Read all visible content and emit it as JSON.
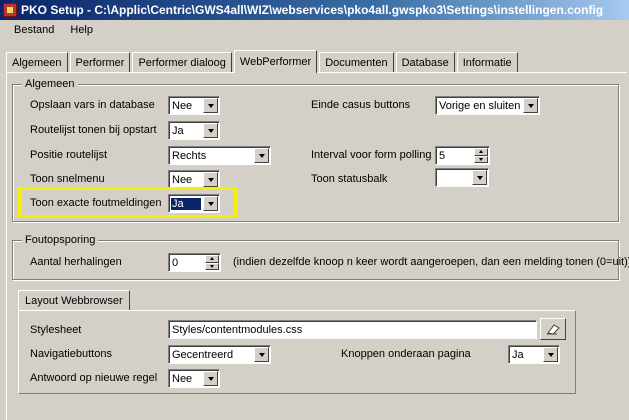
{
  "window": {
    "title": "PKO Setup - C:\\Applic\\Centric\\GWS4all\\WIZ\\webservices\\pko4all.gwspko3\\Settings\\instellingen.config"
  },
  "menu": {
    "items": [
      "Bestand",
      "Help"
    ]
  },
  "tabs": [
    "Algemeen",
    "Performer",
    "Performer dialoog",
    "WebPerformer",
    "Documenten",
    "Database",
    "Informatie"
  ],
  "active_tab": "WebPerformer",
  "algemeen": {
    "legend": "Algemeen",
    "opslaan_vars": {
      "label": "Opslaan vars in database",
      "value": "Nee"
    },
    "routelijst_tonen": {
      "label": "Routelijst tonen bij opstart",
      "value": "Ja"
    },
    "positie_routelijst": {
      "label": "Positie routelijst",
      "value": "Rechts"
    },
    "toon_snelmenu": {
      "label": "Toon snelmenu",
      "value": "Nee"
    },
    "toon_exacte_foutmeldingen": {
      "label": "Toon exacte foutmeldingen",
      "value": "Ja"
    },
    "einde_casus_buttons": {
      "label": "Einde casus buttons",
      "value": "Vorige en sluiten"
    },
    "interval_form_polling": {
      "label": "Interval voor form polling",
      "value": "5"
    },
    "toon_statusbalk": {
      "label": "Toon statusbalk",
      "value": ""
    }
  },
  "foutopsporing": {
    "legend": "Foutopsporing",
    "aantal_herhalingen": {
      "label": "Aantal herhalingen",
      "value": "0"
    },
    "note": "(indien dezelfde knoop n keer wordt aangeroepen, dan een melding tonen (0=uit))"
  },
  "layout_webbrowser": {
    "tab_label": "Layout Webbrowser",
    "stylesheet": {
      "label": "Stylesheet",
      "value": "Styles/contentmodules.css"
    },
    "navigatiebuttons": {
      "label": "Navigatiebuttons",
      "value": "Gecentreerd"
    },
    "knoppen_onderaan": {
      "label": "Knoppen onderaan pagina",
      "value": "Ja"
    },
    "antwoord_nieuwe_regel": {
      "label": "Antwoord op nieuwe regel",
      "value": "Nee"
    }
  },
  "colors": {
    "highlight": "#f5f000",
    "title_bar": "#0a246a",
    "selection": "#0a246a"
  }
}
